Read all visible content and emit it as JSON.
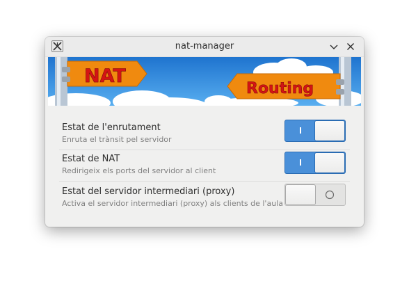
{
  "window": {
    "title": "nat-manager"
  },
  "banner": {
    "left_sign": "NAT",
    "right_sign": "Routing"
  },
  "settings": [
    {
      "title": "Estat de l'enrutament",
      "subtitle": "Enruta el trànsit pel servidor",
      "enabled": true
    },
    {
      "title": "Estat de NAT",
      "subtitle": "Redirigeix els ports del servidor al client",
      "enabled": true
    },
    {
      "title": "Estat del servidor intermediari (proxy)",
      "subtitle": "Activa el servidor intermediari (proxy) als clients de l'aula",
      "enabled": false
    }
  ],
  "colors": {
    "accent": "#4a90d9",
    "sky": "#1e7fd6",
    "sign": "#f08a0f",
    "sign_text": "#d41414"
  }
}
